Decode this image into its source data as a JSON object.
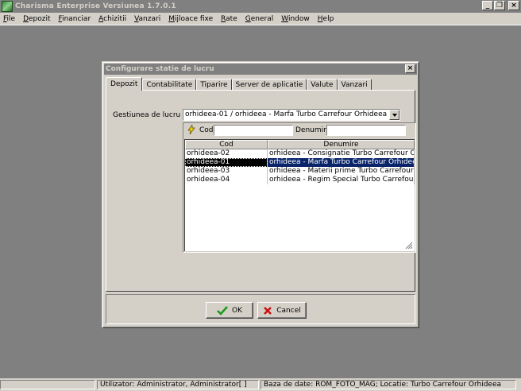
{
  "app": {
    "title": "Charisma Enterprise Versiunea 1.7.0.1",
    "minimize_glyph": "_",
    "restore_glyph": "❐",
    "close_glyph": "×"
  },
  "menu": {
    "items": [
      {
        "accel": "F",
        "rest": "ile"
      },
      {
        "accel": "D",
        "rest": "epozit"
      },
      {
        "accel": "F",
        "rest": "inanciar"
      },
      {
        "accel": "A",
        "rest": "chizitii"
      },
      {
        "accel": "V",
        "rest": "anzari"
      },
      {
        "accel": "M",
        "rest": "ijloace fixe"
      },
      {
        "accel": "R",
        "rest": "ate"
      },
      {
        "accel": "G",
        "rest": "eneral"
      },
      {
        "accel": "W",
        "rest": "indow"
      },
      {
        "accel": "H",
        "rest": "elp"
      }
    ]
  },
  "dialog": {
    "title": "Configurare statie de lucru",
    "close_glyph": "×",
    "tabs": [
      "Depozit",
      "Contabilitate",
      "Tiparire",
      "Server de aplicatie",
      "Valute",
      "Vanzari"
    ],
    "active_tab": 0,
    "gestiune": {
      "label": "Gestiunea de lucru",
      "value": "orhideea-01 / orhideea - Marfa Turbo Carrefour Orhideea"
    },
    "lookup": {
      "cod_label": "Cod",
      "cod_value": "",
      "denumire_label": "Denumire",
      "denumire_value": "",
      "columns": [
        "Cod",
        "Denumire"
      ],
      "rows": [
        {
          "cod": "orhideea-02",
          "denumire": "orhideea - Consignatie Turbo Carrefour Orhideea"
        },
        {
          "cod": "orhideea-01",
          "denumire": "orhideea - Marfa Turbo Carrefour Orhideea"
        },
        {
          "cod": "orhideea-03",
          "denumire": "orhideea - Materii prime Turbo Carrefour Orhideea"
        },
        {
          "cod": "orhideea-04",
          "denumire": "orhideea - Regim Special Turbo Carrefour Orhideea"
        }
      ],
      "selected_row": 1
    },
    "buttons": {
      "ok": "OK",
      "cancel": "Cancel"
    }
  },
  "statusbar": {
    "panel1": "",
    "panel2": "Utilizator: Administrator, Administrator[ ]",
    "panel3": "Baza de date: ROM_FOTO_MAG; Locatie: Turbo Carrefour Orhideea"
  },
  "colors": {
    "desktop": "#808080",
    "face": "#d4d0c8",
    "selection": "#0a246a",
    "ok_check": "#1e9a1e",
    "cancel_x": "#cc1111"
  }
}
